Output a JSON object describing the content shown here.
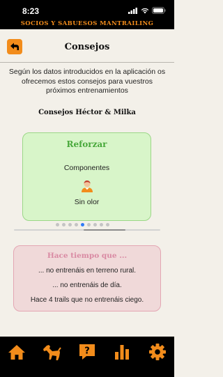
{
  "status": {
    "time": "8:23"
  },
  "banner": "SOCIOS Y SABUESOS MANTRAILING",
  "header": {
    "title": "Consejos",
    "back_icon": "back-arrow-icon"
  },
  "intro": "Según los datos introducidos en la aplicación os ofrecemos estos consejos para vuestros próximos entrenamientos",
  "subtitle": "Consejos Héctor & Milka",
  "card": {
    "title": "Reforzar",
    "line1": "Componentes",
    "icon": "person-icon",
    "line2": "Sin olor"
  },
  "pager": {
    "count": 9,
    "active_index": 4
  },
  "hint": {
    "title": "Hace tiempo que ...",
    "lines": [
      "... no entrenáis en terreno rural.",
      "... no entrenáis de día.",
      "Hace 4 trails que no entrenáis ciego."
    ]
  },
  "colors": {
    "accent": "#f28c1b",
    "card_green": "#d8f5c9",
    "card_pink": "#f0d9d9",
    "pager_active": "#2f7bf6"
  },
  "tabs": [
    {
      "name": "home",
      "icon": "home-icon"
    },
    {
      "name": "dog",
      "icon": "dog-icon"
    },
    {
      "name": "advice",
      "icon": "question-icon"
    },
    {
      "name": "stats",
      "icon": "bar-chart-icon"
    },
    {
      "name": "settings",
      "icon": "gear-icon"
    }
  ]
}
